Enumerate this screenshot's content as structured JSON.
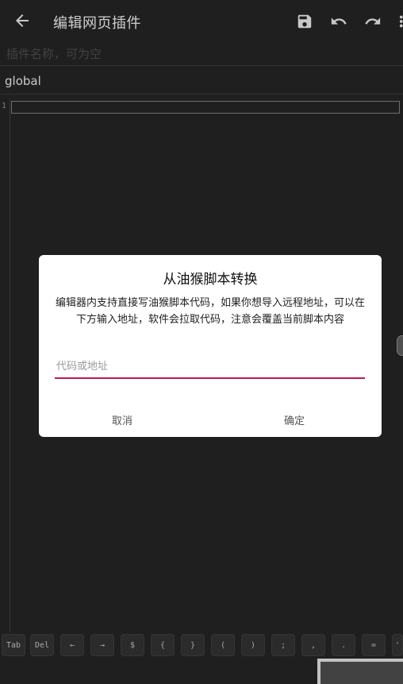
{
  "header": {
    "title": "编辑网页插件"
  },
  "fields": {
    "name_placeholder": "插件名称，可为空",
    "scope_value": "global"
  },
  "editor": {
    "line_numbers": [
      "1"
    ]
  },
  "keybar": {
    "keys": [
      "Tab",
      "Del",
      "←",
      "→",
      "$",
      "{",
      "}",
      "(",
      ")",
      ";",
      ",",
      ".",
      "=",
      "'"
    ]
  },
  "dialog": {
    "title": "从油猴脚本转换",
    "message": "编辑器内支持直接写油猴脚本代码，如果你想导入远程地址，可以在下方输入地址，软件会拉取代码，注意会覆盖当前脚本内容",
    "input_placeholder": "代码或地址",
    "cancel_label": "取消",
    "confirm_label": "确定"
  },
  "colors": {
    "accent": "#c2185b",
    "background": "#232323"
  }
}
